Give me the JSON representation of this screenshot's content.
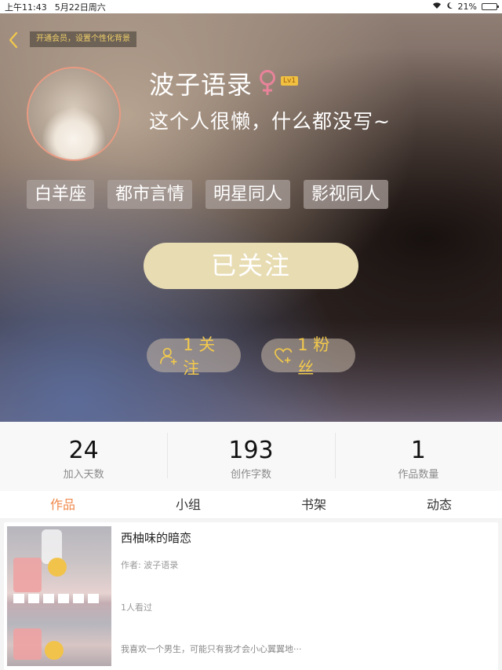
{
  "status_bar": {
    "time": "上午11:43",
    "date": "5月22日周六",
    "battery": "21%",
    "battery_level": 0.21
  },
  "header": {
    "member_tip": "开通会员，设置个性化背景"
  },
  "profile": {
    "username": "波子语录",
    "gender_icon": "female-icon",
    "level": "Lv1",
    "signature": "这个人很懒，什么都没写~",
    "tags": [
      "白羊座",
      "都市言情",
      "明星同人",
      "影视同人"
    ],
    "follow_button": "已关注",
    "following_label": "1 关注",
    "fans_label": "1 粉丝"
  },
  "stats": [
    {
      "value": "24",
      "label": "加入天数"
    },
    {
      "value": "193",
      "label": "创作字数"
    },
    {
      "value": "1",
      "label": "作品数量"
    }
  ],
  "tabs": [
    {
      "label": "作品",
      "active": true
    },
    {
      "label": "小组",
      "active": false
    },
    {
      "label": "书架",
      "active": false
    },
    {
      "label": "动态",
      "active": false
    }
  ],
  "book": {
    "title": "西柚味的暗恋",
    "author": "作者: 波子语录",
    "readers": "1人看过",
    "description": "我喜欢一个男生，可能只有我才会小心翼翼地···"
  },
  "colors": {
    "accent": "#f0884a",
    "gold": "#f2c94c",
    "follow_button_bg": "#e8dcb3",
    "gender": "#e8839a"
  }
}
